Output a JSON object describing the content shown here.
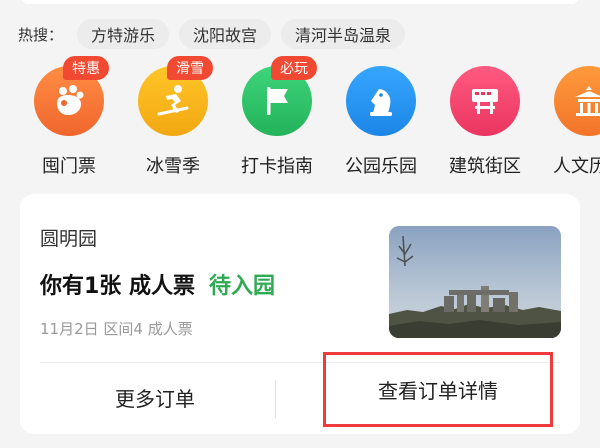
{
  "search": {
    "hot_label": "热搜：",
    "chips": [
      "方特游乐",
      "沈阳故宫",
      "清河半岛温泉"
    ]
  },
  "categories": [
    {
      "label": "囤门票",
      "badge": "特惠",
      "color": "#f5733a",
      "icon": "hand-icon"
    },
    {
      "label": "冰雪季",
      "badge": "滑雪",
      "color": "#f7b21b",
      "icon": "skier-icon"
    },
    {
      "label": "打卡指南",
      "badge": "必玩",
      "color": "#2fc46a",
      "icon": "flag-icon"
    },
    {
      "label": "公园乐园",
      "badge": "",
      "color": "#2a96f0",
      "icon": "chess-knight-icon"
    },
    {
      "label": "建筑街区",
      "badge": "",
      "color": "#f2456a",
      "icon": "signboard-icon"
    },
    {
      "label": "人文历史",
      "badge": "",
      "color": "#f5802c",
      "icon": "temple-icon"
    }
  ],
  "order": {
    "place": "圆明园",
    "tickets": "你有1张 成人票",
    "status": "待入园",
    "detail": "11月2日  区间4 成人票",
    "more_button": "更多订单",
    "detail_button": "查看订单详情"
  },
  "colors": {
    "status_green": "#2eaa52",
    "highlight_red": "#ef3b3b",
    "badge_red": "#f24a32"
  }
}
